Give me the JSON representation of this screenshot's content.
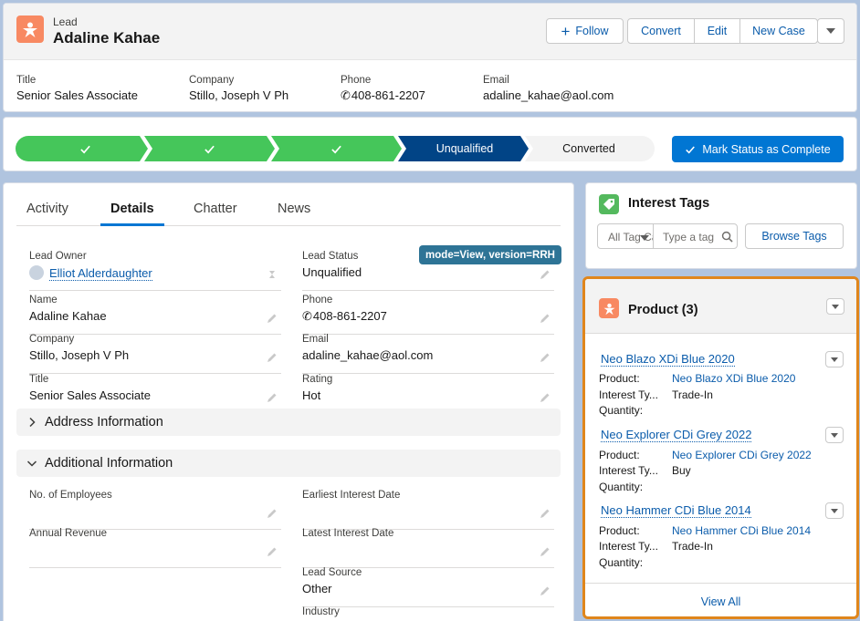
{
  "header": {
    "record_type": "Lead",
    "record_name": "Adaline Kahae",
    "buttons": {
      "follow": "Follow",
      "convert": "Convert",
      "edit": "Edit",
      "new_case": "New Case"
    },
    "highlights": [
      {
        "label": "Title",
        "value": "Senior Sales Associate"
      },
      {
        "label": "Company",
        "value": "Stillo, Joseph V Ph"
      },
      {
        "label": "Phone",
        "value": "408-861-2207"
      },
      {
        "label": "Email",
        "value": "adaline_kahae@aol.com"
      }
    ]
  },
  "path": {
    "current_stage": "Unqualified",
    "next_stage": "Converted",
    "completed_steps": 3,
    "mark_button": "Mark Status as Complete",
    "colors": {
      "complete": "#45c65a",
      "current": "#014486",
      "upcoming": "#f3f3f3"
    }
  },
  "tabs": [
    "Activity",
    "Details",
    "Chatter",
    "News"
  ],
  "active_tab": "Details",
  "debug_badge": "mode=View, version=RRH",
  "details": {
    "lead_owner_label": "Lead Owner",
    "lead_owner_value": "Elliot Alderdaughter",
    "lead_status_label": "Lead Status",
    "lead_status_value": "Unqualified",
    "name_label": "Name",
    "name_value": "Adaline Kahae",
    "phone_label": "Phone",
    "phone_value": "408-861-2207",
    "company_label": "Company",
    "company_value": "Stillo, Joseph V Ph",
    "email_label": "Email",
    "email_value": "adaline_kahae@aol.com",
    "title_label": "Title",
    "title_value": "Senior Sales Associate",
    "rating_label": "Rating",
    "rating_value": "Hot"
  },
  "sections": {
    "address": "Address Information",
    "additional": "Additional Information"
  },
  "additional": {
    "employees_label": "No. of Employees",
    "earliest_label": "Earliest Interest Date",
    "revenue_label": "Annual Revenue",
    "latest_label": "Latest Interest Date",
    "source_label": "Lead Source",
    "source_value": "Other",
    "industry_label": "Industry"
  },
  "interest_tags": {
    "title": "Interest Tags",
    "select_value": "All Tag Ca",
    "input_placeholder": "Type a tag",
    "browse_button": "Browse Tags"
  },
  "products": {
    "title": "Product (3)",
    "field_labels": {
      "product": "Product:",
      "interest_type": "Interest Ty...",
      "quantity": "Quantity:"
    },
    "items": [
      {
        "name": "Neo Blazo XDi Blue 2020",
        "product": "Neo Blazo XDi Blue 2020",
        "interest_type": "Trade-In"
      },
      {
        "name": "Neo Explorer CDi Grey 2022",
        "product": "Neo Explorer CDi Grey 2022",
        "interest_type": "Buy"
      },
      {
        "name": "Neo Hammer CDi Blue 2014",
        "product": "Neo Hammer CDi Blue 2014",
        "interest_type": "Trade-In"
      }
    ],
    "view_all": "View All"
  }
}
